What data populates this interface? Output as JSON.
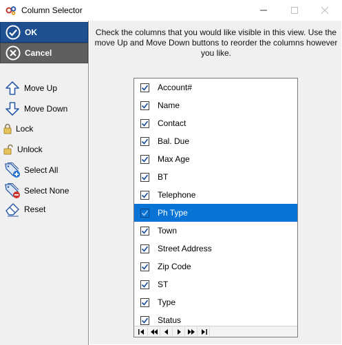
{
  "window": {
    "title": "Column Selector",
    "icon": "gears-icon",
    "controls": [
      "minimize",
      "maximize",
      "close"
    ]
  },
  "actions": {
    "ok_label": "OK",
    "cancel_label": "Cancel"
  },
  "sidebar": {
    "items": [
      {
        "label": "Move Up",
        "icon": "arrow-up-icon"
      },
      {
        "label": "Move Down",
        "icon": "arrow-down-icon"
      },
      {
        "label": "Lock",
        "icon": "lock-icon"
      },
      {
        "label": "Unlock",
        "icon": "unlock-icon"
      },
      {
        "label": "Select All",
        "icon": "tags-add-icon"
      },
      {
        "label": "Select None",
        "icon": "tags-remove-icon"
      },
      {
        "label": "Reset",
        "icon": "eraser-icon"
      }
    ]
  },
  "instructions": "Check the columns that you would like visible in this view. Use the move Up and Move Down buttons to reorder the columns however you like.",
  "columns": [
    {
      "label": "Account#",
      "checked": true,
      "selected": false
    },
    {
      "label": "Name",
      "checked": true,
      "selected": false
    },
    {
      "label": "Contact",
      "checked": true,
      "selected": false
    },
    {
      "label": "Bal. Due",
      "checked": true,
      "selected": false
    },
    {
      "label": "Max Age",
      "checked": true,
      "selected": false
    },
    {
      "label": "BT",
      "checked": true,
      "selected": false
    },
    {
      "label": "Telephone",
      "checked": true,
      "selected": false
    },
    {
      "label": "Ph Type",
      "checked": true,
      "selected": true
    },
    {
      "label": "Town",
      "checked": true,
      "selected": false
    },
    {
      "label": "Street Address",
      "checked": true,
      "selected": false
    },
    {
      "label": "Zip Code",
      "checked": true,
      "selected": false
    },
    {
      "label": "ST",
      "checked": true,
      "selected": false
    },
    {
      "label": "Type",
      "checked": true,
      "selected": false
    },
    {
      "label": "Status",
      "checked": true,
      "selected": false
    }
  ],
  "colors": {
    "ok_bg": "#1d4f91",
    "cancel_bg": "#5f5f5f",
    "selection": "#0a74d6",
    "icon_blue": "#2a5aa8"
  }
}
